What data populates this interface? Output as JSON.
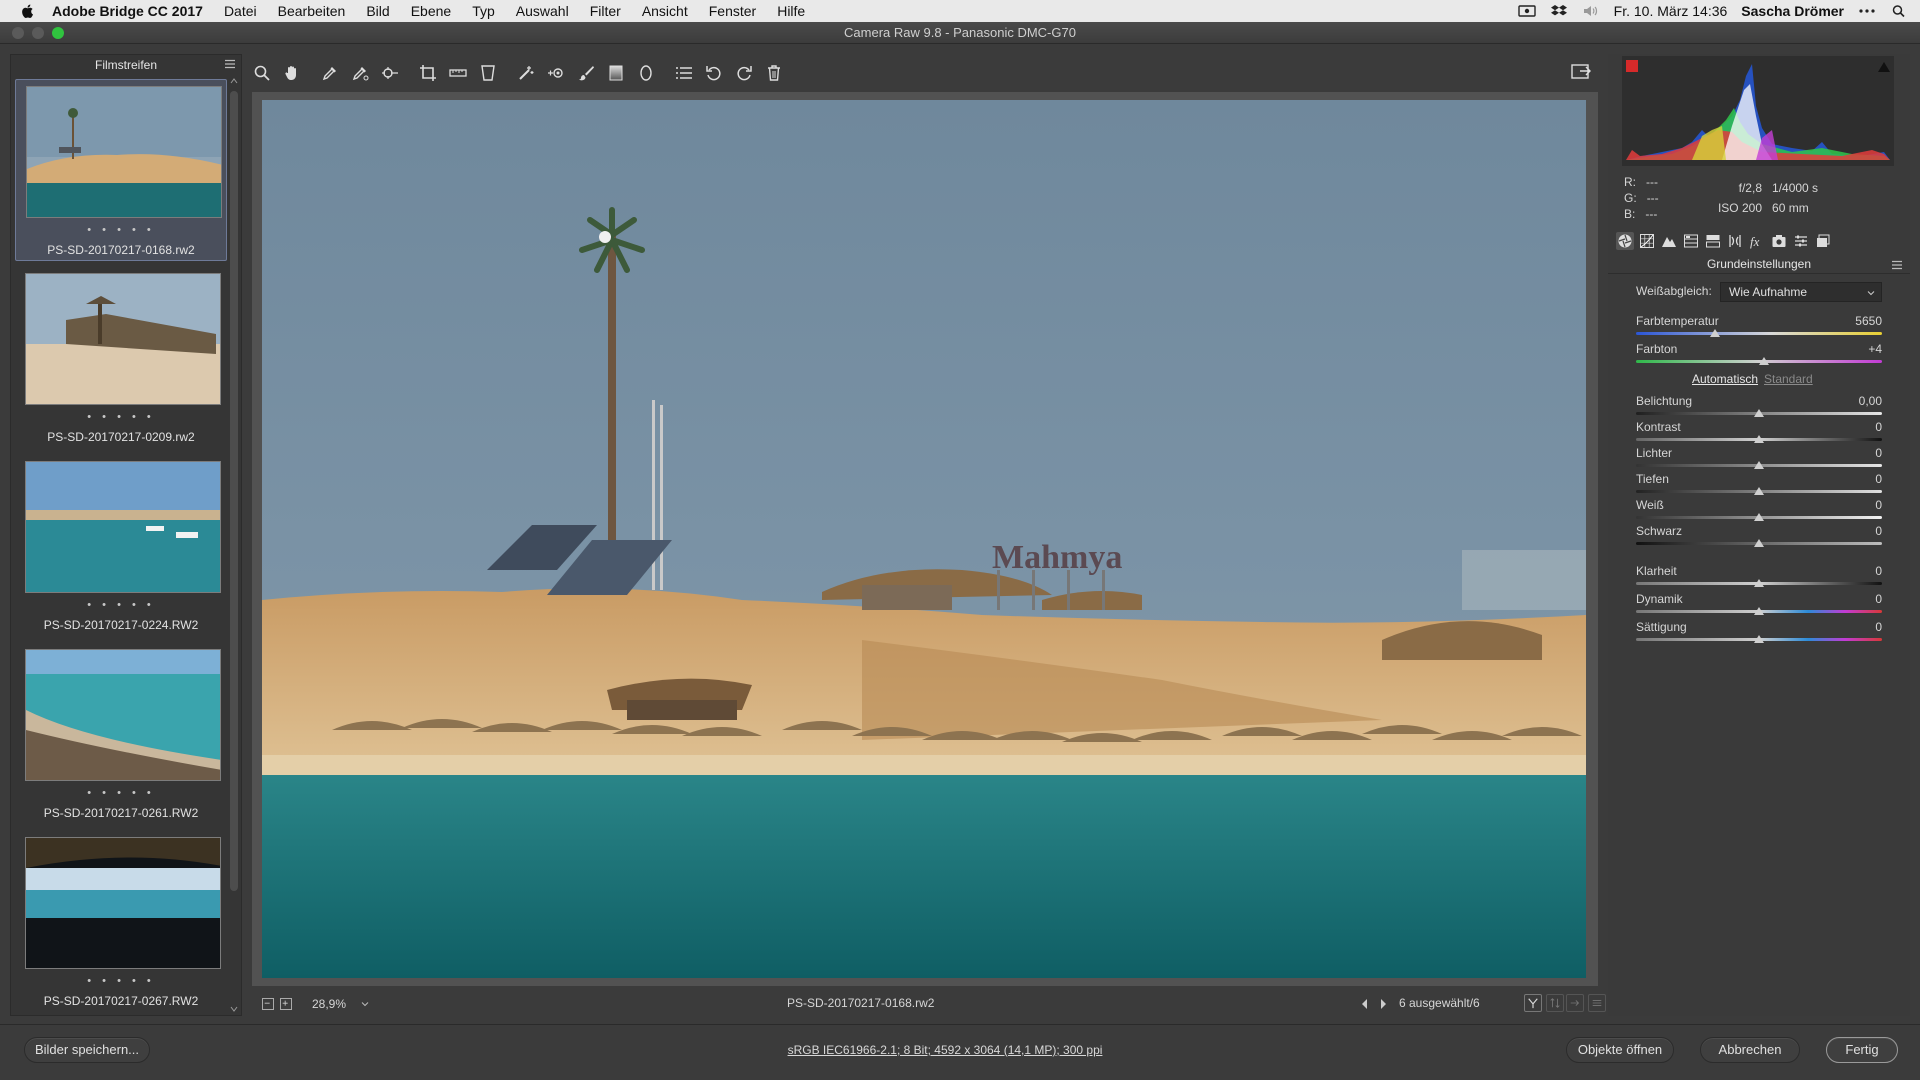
{
  "menubar": {
    "app_name": "Adobe Bridge CC 2017",
    "items": [
      "Datei",
      "Bearbeiten",
      "Bild",
      "Ebene",
      "Typ",
      "Auswahl",
      "Filter",
      "Ansicht",
      "Fenster",
      "Hilfe"
    ],
    "datetime": "Fr. 10. März 14:36",
    "user": "Sascha Drömer"
  },
  "window": {
    "title": "Camera Raw 9.8 - Panasonic DMC-G70"
  },
  "filmstrip": {
    "title": "Filmstreifen",
    "rating_dots": "• • • • •",
    "items": [
      {
        "filename": "PS-SD-20170217-0168.rw2",
        "selected": true
      },
      {
        "filename": "PS-SD-20170217-0209.rw2",
        "selected": false
      },
      {
        "filename": "PS-SD-20170217-0224.RW2",
        "selected": false
      },
      {
        "filename": "PS-SD-20170217-0261.RW2",
        "selected": false
      },
      {
        "filename": "PS-SD-20170217-0267.RW2",
        "selected": false
      }
    ]
  },
  "preview": {
    "sign_text": "Mahmya",
    "zoom": "28,9%",
    "filename": "PS-SD-20170217-0168.rw2",
    "selection_count": "6 ausgewählt/6"
  },
  "info": {
    "r_label": "R:",
    "r_value": "---",
    "g_label": "G:",
    "g_value": "---",
    "b_label": "B:",
    "b_value": "---",
    "aperture": "f/2,8",
    "shutter": "1/4000 s",
    "iso": "ISO 200",
    "focal": "60 mm"
  },
  "basic_panel": {
    "title": "Grundeinstellungen",
    "wb_label": "Weißabgleich:",
    "wb_value": "Wie Aufnahme",
    "auto_label": "Automatisch",
    "standard_label": "Standard",
    "sliders": [
      {
        "label": "Farbtemperatur",
        "value": "5650",
        "pos": 0.32
      },
      {
        "label": "Farbton",
        "value": "+4",
        "pos": 0.52
      },
      {
        "label": "Belichtung",
        "value": "0,00",
        "pos": 0.5
      },
      {
        "label": "Kontrast",
        "value": "0",
        "pos": 0.5
      },
      {
        "label": "Lichter",
        "value": "0",
        "pos": 0.5
      },
      {
        "label": "Tiefen",
        "value": "0",
        "pos": 0.5
      },
      {
        "label": "Weiß",
        "value": "0",
        "pos": 0.5
      },
      {
        "label": "Schwarz",
        "value": "0",
        "pos": 0.5
      },
      {
        "label": "Klarheit",
        "value": "0",
        "pos": 0.5
      },
      {
        "label": "Dynamik",
        "value": "0",
        "pos": 0.5
      },
      {
        "label": "Sättigung",
        "value": "0",
        "pos": 0.5
      }
    ]
  },
  "bottombar": {
    "save_label": "Bilder speichern...",
    "workflow_text": "sRGB IEC61966-2.1; 8 Bit; 4592 x 3064 (14,1 MP); 300 ppi",
    "open_label": "Objekte öffnen",
    "cancel_label": "Abbrechen",
    "done_label": "Fertig"
  },
  "colors": {
    "accent": "#6e7a98",
    "sky": "#6f8aa0",
    "sand": "#d7b07d",
    "sea": "#1f6f73"
  }
}
